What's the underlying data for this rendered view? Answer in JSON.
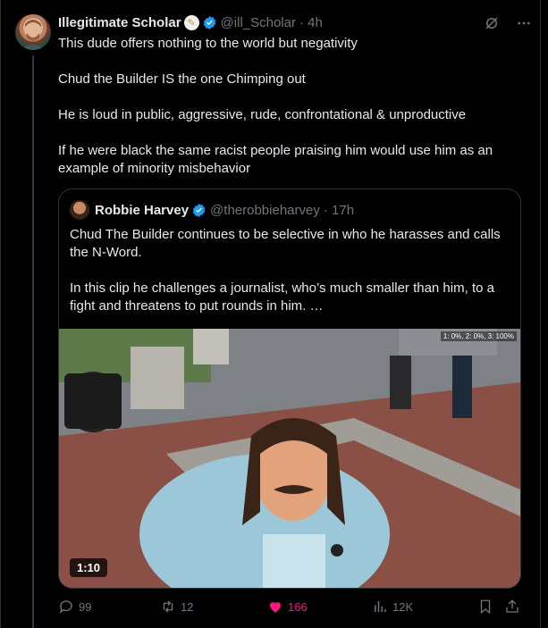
{
  "tweet": {
    "display_name": "Illegitimate Scholar",
    "handle": "@ill_Scholar",
    "time": "· 4h",
    "paragraphs": [
      "This dude offers nothing to the world but negativity",
      "Chud the Builder IS the one Chimping out",
      "He is loud in public, aggressive, rude, confrontational & unproductive",
      "If he were black the same racist people praising him would use him as an example of minority misbehavior"
    ]
  },
  "quote": {
    "display_name": "Robbie Harvey",
    "handle": "@therobbieharvey",
    "time": "· 17h",
    "paragraphs": [
      "Chud The Builder continues to be selective in who he harasses and calls the N-Word.",
      "In this clip he challenges a journalist, who’s much smaller than him, to a fight and threatens to put rounds in him. …"
    ],
    "video": {
      "duration": "1:10",
      "stats_overlay": "1: 0%, 2: 0%, 3: 100%"
    }
  },
  "actions": {
    "replies": "99",
    "reposts": "12",
    "likes": "166",
    "views": "12K"
  },
  "colors": {
    "background": "#000000",
    "text": "#e7e9ea",
    "muted": "#71767b",
    "verified": "#1d9bf0",
    "like": "#f91880"
  },
  "icons": [
    "grok-icon",
    "more-icon",
    "verified-icon",
    "reply-icon",
    "repost-icon",
    "like-icon",
    "views-icon",
    "bookmark-icon",
    "share-icon"
  ]
}
